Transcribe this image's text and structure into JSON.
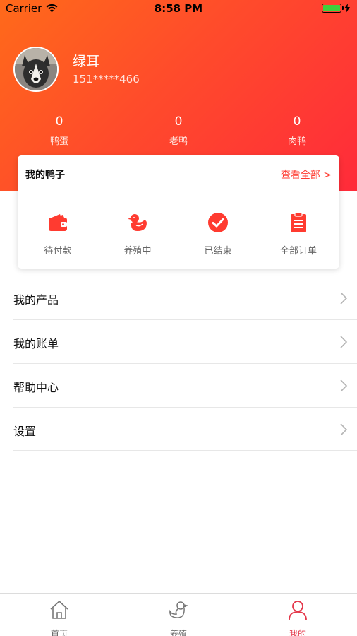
{
  "status_bar": {
    "carrier": "Carrier",
    "time": "8:58 PM"
  },
  "profile": {
    "name": "绿耳",
    "phone": "151*****466"
  },
  "stats": [
    {
      "value": "0",
      "label": "鸭蛋"
    },
    {
      "value": "0",
      "label": "老鸭"
    },
    {
      "value": "0",
      "label": "肉鸭"
    }
  ],
  "my_ducks": {
    "title": "我的鸭子",
    "view_all": "查看全部 >",
    "orders": [
      {
        "label": "待付款",
        "icon": "wallet-icon"
      },
      {
        "label": "养殖中",
        "icon": "duck-icon"
      },
      {
        "label": "已结束",
        "icon": "check-circle-icon"
      },
      {
        "label": "全部订单",
        "icon": "clipboard-icon"
      }
    ]
  },
  "menu": [
    {
      "label": "我的产品"
    },
    {
      "label": "我的账单"
    },
    {
      "label": "帮助中心"
    },
    {
      "label": "设置"
    }
  ],
  "tabbar": [
    {
      "label": "首页",
      "icon": "home-icon"
    },
    {
      "label": "养殖",
      "icon": "duck-outline-icon"
    },
    {
      "label": "我的",
      "icon": "person-icon",
      "active": true
    }
  ],
  "colors": {
    "accent": "#ff3b30",
    "header_start": "#ff6a1a",
    "header_end": "#ff2b3a",
    "active_tab": "#e4374a"
  }
}
